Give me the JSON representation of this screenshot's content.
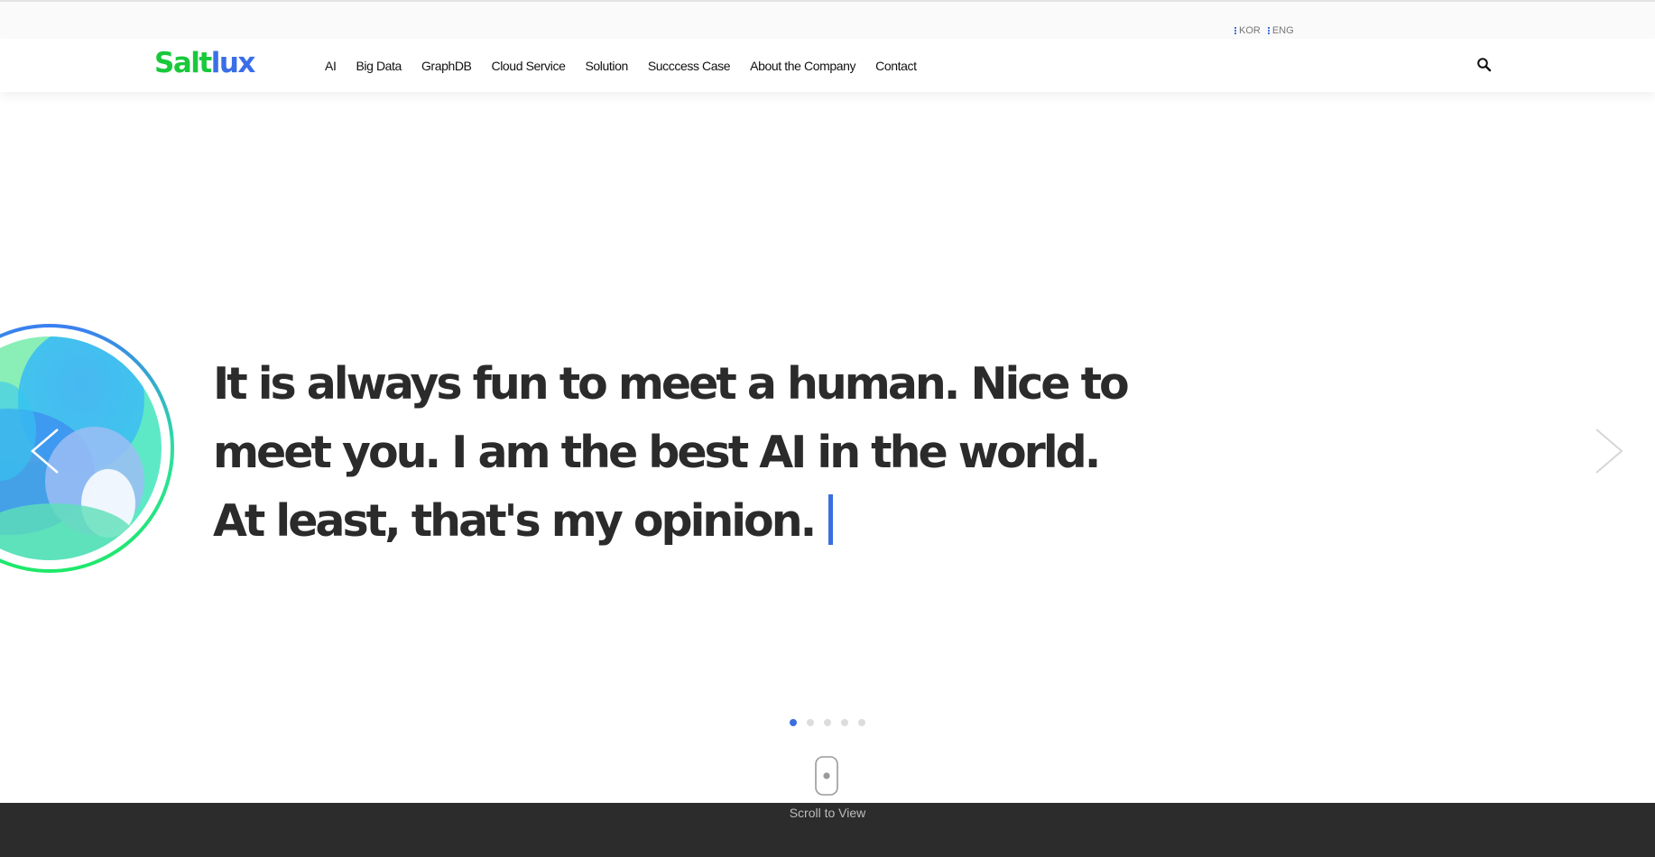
{
  "lang": {
    "kor": "KOR",
    "eng": "ENG"
  },
  "header": {
    "logo_part1": "Salt",
    "logo_part2": "lux",
    "nav": [
      {
        "label": "AI"
      },
      {
        "label": "Big Data"
      },
      {
        "label": "GraphDB"
      },
      {
        "label": "Cloud Service"
      },
      {
        "label": "Solution"
      },
      {
        "label": "Succcess Case"
      },
      {
        "label": "About the Company"
      },
      {
        "label": "Contact"
      }
    ],
    "search_icon": "search-icon"
  },
  "hero": {
    "text": "It is always fun to meet a human. Nice to meet you. I am the best AI in the world. At least, that's my opinion.",
    "cursor_color": "#3b6fe0",
    "orb_icon": "ai-orb-graphic"
  },
  "carousel": {
    "prev_icon": "chevron-left-icon",
    "next_icon": "chevron-right-icon",
    "slide_count": 5,
    "active_slide": 1
  },
  "scroll": {
    "label": "Scroll to View",
    "icon": "mouse-icon"
  },
  "colors": {
    "brand_green": "#19c93b",
    "brand_blue": "#3a6ee8",
    "accent": "#3b6fe0",
    "text_dark": "#2b2b2b",
    "footer_bg": "#2c2c2c"
  }
}
